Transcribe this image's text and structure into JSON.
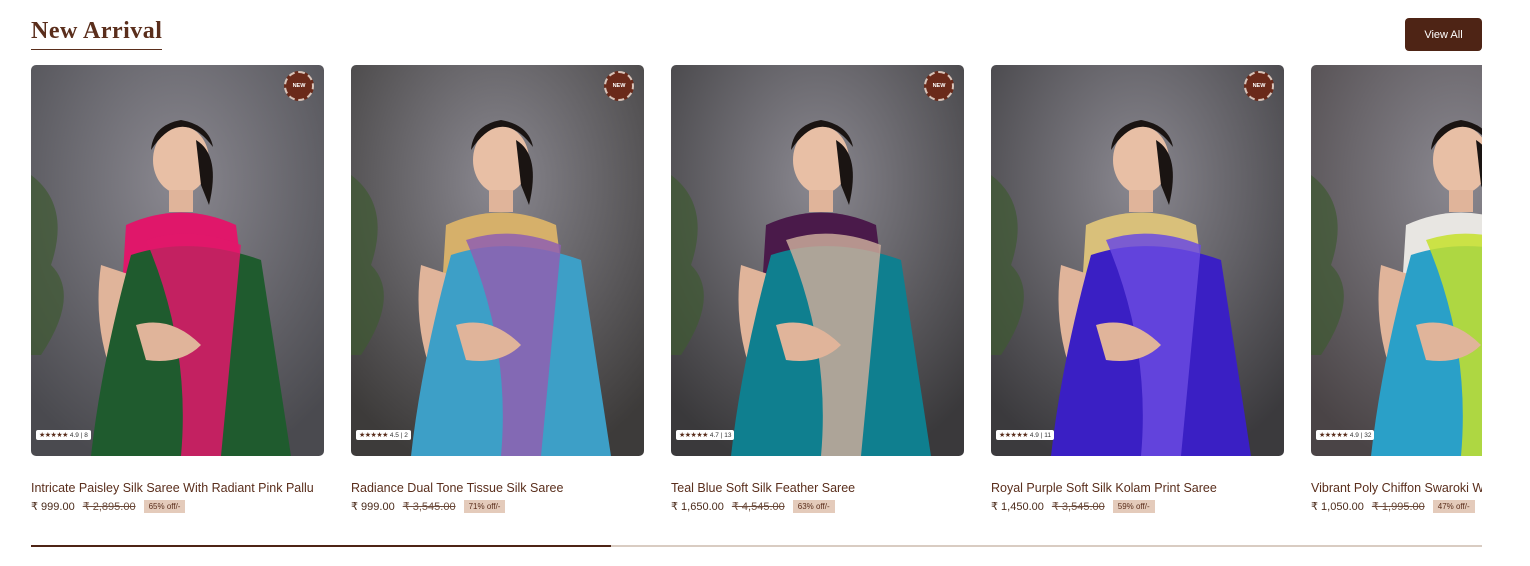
{
  "section": {
    "title": "New Arrival",
    "view_all_label": "View All"
  },
  "products": [
    {
      "name": "Intricate Paisley Silk Saree With Radiant Pink Pallu",
      "badge": "NEW",
      "rating_text": "4.9 | 8",
      "price": "₹ 999.00",
      "mrp": "₹ 2,895.00",
      "discount": "65% off/-",
      "colors": {
        "bg": "#4a4a4f",
        "body": "#1f5b2e",
        "accent": "#e0176a",
        "blouse": "#e0176a"
      }
    },
    {
      "name": "Radiance Dual Tone Tissue Silk Saree",
      "badge": "NEW",
      "rating_text": "4.5 | 2",
      "price": "₹ 999.00",
      "mrp": "₹ 3,545.00",
      "discount": "71% off/-",
      "colors": {
        "bg": "#3d3b3a",
        "body": "#3d9fc7",
        "accent": "#8f5fb0",
        "blouse": "#d6b06a"
      }
    },
    {
      "name": "Teal Blue Soft Silk Feather Saree",
      "badge": "NEW",
      "rating_text": "4.7 | 13",
      "price": "₹ 1,650.00",
      "mrp": "₹ 4,545.00",
      "discount": "63% off/-",
      "colors": {
        "bg": "#3a393b",
        "body": "#0f7f8f",
        "accent": "#c9aa9a",
        "blouse": "#4a1a4a"
      }
    },
    {
      "name": "Royal Purple Soft Silk Kolam Print Saree",
      "badge": "NEW",
      "rating_text": "4.9 | 11",
      "price": "₹ 1,450.00",
      "mrp": "₹ 3,545.00",
      "discount": "59% off/-",
      "colors": {
        "bg": "#3b3a3d",
        "body": "#3a1fc4",
        "accent": "#6a4ae0",
        "blouse": "#d9c07a"
      }
    },
    {
      "name": "Vibrant Poly Chiffon Swaroki Work Saree",
      "badge": "",
      "rating_text": "4.9 | 32",
      "price": "₹ 1,050.00",
      "mrp": "₹ 1,995.00",
      "discount": "47% off/-",
      "colors": {
        "bg": "#4a4446",
        "body": "#2aa0c8",
        "accent": "#c6e02a",
        "blouse": "#e8e6e2"
      }
    }
  ],
  "progress": {
    "fraction": 0.4
  },
  "colors": {
    "brand": "#4e2415",
    "discount_bg": "#e4cbbb"
  }
}
